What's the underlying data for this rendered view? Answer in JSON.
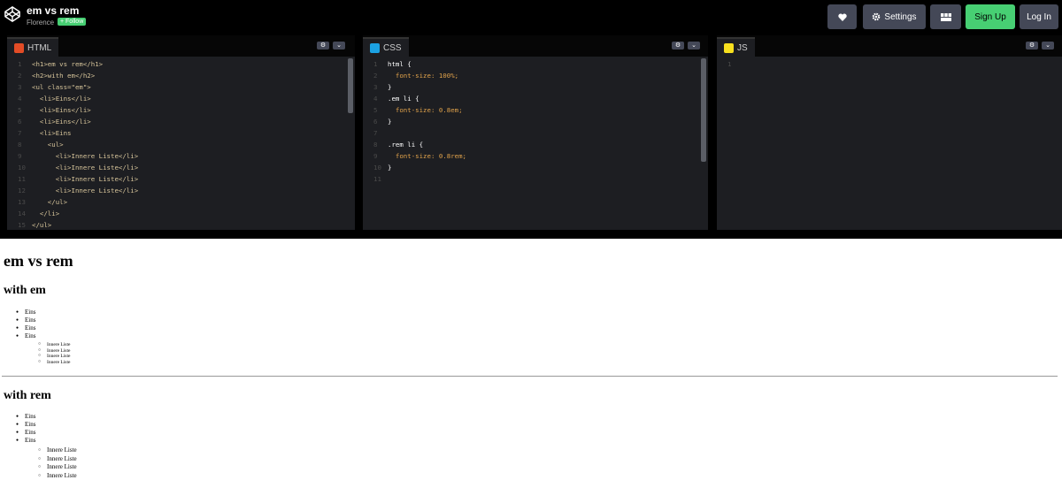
{
  "header": {
    "title": "em vs rem",
    "author": "Florence",
    "follow_label": "+ Follow",
    "settings_label": "Settings",
    "signup_label": "Sign Up",
    "login_label": "Log In",
    "colors": {
      "bar": "#000000",
      "button": "#444857",
      "signup": "#47cf73"
    }
  },
  "editors": {
    "html": {
      "tab_label": "HTML",
      "lines": [
        {
          "n": "1",
          "text": "<h1>em vs rem</h1>"
        },
        {
          "n": "2",
          "text": "<h2>with em</h2>"
        },
        {
          "n": "3",
          "text": "<ul class=\"em\">"
        },
        {
          "n": "4",
          "text": "  <li>Eins</li>"
        },
        {
          "n": "5",
          "text": "  <li>Eins</li>"
        },
        {
          "n": "6",
          "text": "  <li>Eins</li>"
        },
        {
          "n": "7",
          "text": "  <li>Eins"
        },
        {
          "n": "8",
          "text": "    <ul>"
        },
        {
          "n": "9",
          "text": "      <li>Innere Liste</li>"
        },
        {
          "n": "10",
          "text": "      <li>Innere Liste</li>"
        },
        {
          "n": "11",
          "text": "      <li>Innere Liste</li>"
        },
        {
          "n": "12",
          "text": "      <li>Innere Liste</li>"
        },
        {
          "n": "13",
          "text": "    </ul>"
        },
        {
          "n": "14",
          "text": "  </li>"
        },
        {
          "n": "15",
          "text": "</ul>"
        }
      ]
    },
    "css": {
      "tab_label": "CSS",
      "lines": [
        {
          "n": "1",
          "text": "html {"
        },
        {
          "n": "2",
          "text": "  font-size: 100%;"
        },
        {
          "n": "3",
          "text": "}"
        },
        {
          "n": "4",
          "text": ".em li {"
        },
        {
          "n": "5",
          "text": "  font-size: 0.8em;"
        },
        {
          "n": "6",
          "text": "}"
        },
        {
          "n": "7",
          "text": ""
        },
        {
          "n": "8",
          "text": ".rem li {"
        },
        {
          "n": "9",
          "text": "  font-size: 0.8rem;"
        },
        {
          "n": "10",
          "text": "}"
        },
        {
          "n": "11",
          "text": ""
        }
      ]
    },
    "js": {
      "tab_label": "JS",
      "lines": [
        {
          "n": "1",
          "text": ""
        }
      ]
    }
  },
  "preview": {
    "h1": "em vs rem",
    "section_em": {
      "heading": "with em",
      "items": [
        "Eins",
        "Eins",
        "Eins",
        "Eins"
      ],
      "inner_items": [
        "Innere Liste",
        "Innere Liste",
        "Innere Liste",
        "Innere Liste"
      ]
    },
    "section_rem": {
      "heading": "with rem",
      "items": [
        "Eins",
        "Eins",
        "Eins",
        "Eins"
      ],
      "inner_items": [
        "Innere Liste",
        "Innere Liste",
        "Innere Liste",
        "Innere Liste"
      ]
    }
  }
}
